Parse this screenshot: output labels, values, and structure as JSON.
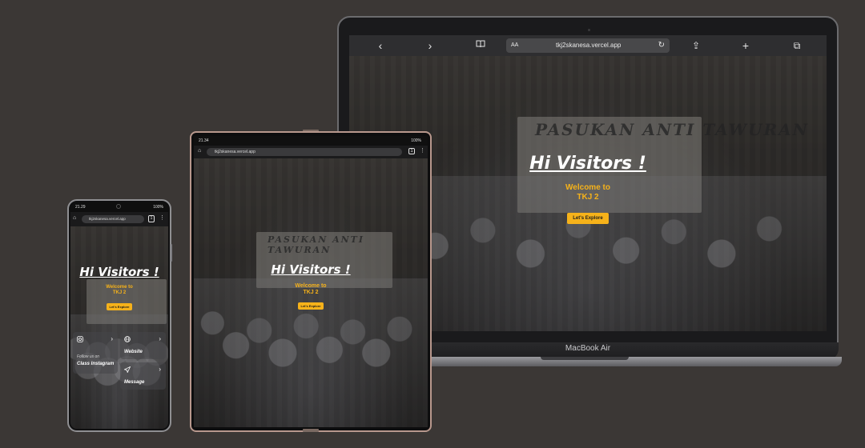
{
  "laptop": {
    "label": "MacBook Air",
    "toolbar": {
      "back_icon": "‹",
      "forward_icon": "›",
      "reader_icon": "📖",
      "url_prefix": "AA",
      "url": "tkj2skanesa.vercel.app",
      "reload_icon": "↻",
      "share_icon": "⇪",
      "new_tab_icon": "+",
      "tabs_icon": "⧉"
    },
    "hero": {
      "title": "Hi Visitors !",
      "subtitle_line1": "Welcome to",
      "subtitle_line2": "TKJ 2",
      "button_label": "Let's Explore"
    },
    "banner_text": "PASUKAN ANTI TAWURAN"
  },
  "tablet": {
    "status_time": "21.34",
    "status_right": "100%",
    "url": "tkj2skanesa.vercel.app",
    "hero": {
      "title": "Hi Visitors !",
      "subtitle_line1": "Welcome to",
      "subtitle_line2": "TKJ 2",
      "button_label": "Let's Explore"
    },
    "banner_text": "PASUKAN ANTI TAWURAN"
  },
  "phone": {
    "status_time": "21.29",
    "status_right": "100%",
    "url": "tkj2skanesa.vercel.app",
    "hero": {
      "title": "Hi Visitors !",
      "subtitle_line1": "Welcome to",
      "subtitle_line2": "TKJ 2",
      "button_label": "Let's Explore"
    },
    "cards": {
      "instagram": {
        "sub": "Follow us on",
        "main": "Class Instagram"
      },
      "website": {
        "main": "Website"
      },
      "message": {
        "main": "Message"
      }
    }
  },
  "colors": {
    "background": "#3b3735",
    "accent": "#f6b21a"
  }
}
